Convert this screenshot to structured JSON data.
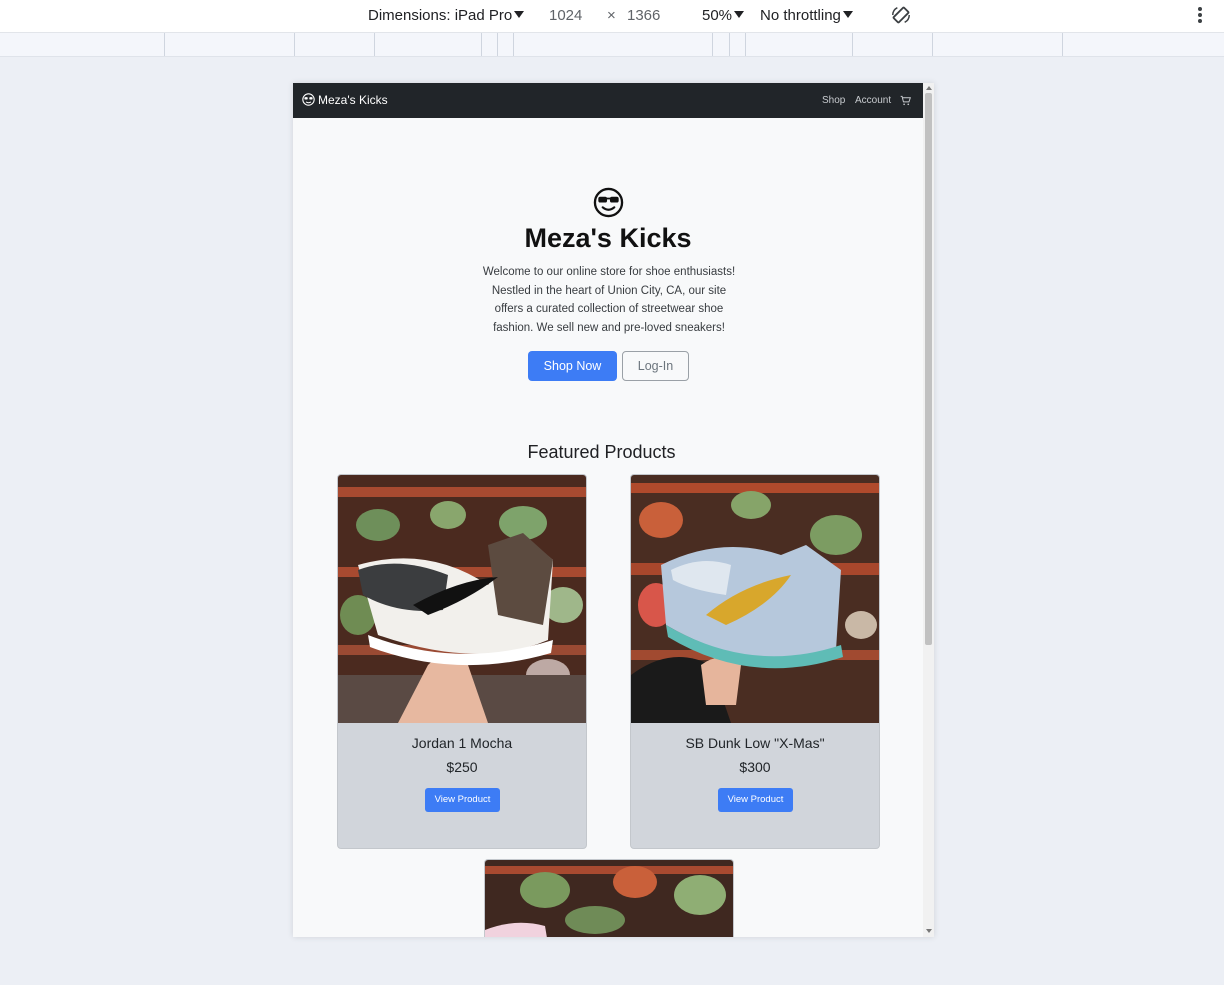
{
  "devtools": {
    "dimensions_label": "Dimensions: iPad Pro",
    "width": "1024",
    "times_symbol": "×",
    "height": "1366",
    "zoom": "50%",
    "throttling": "No throttling"
  },
  "site": {
    "brand": "Meza's Kicks",
    "nav": {
      "shop": "Shop",
      "account": "Account"
    },
    "hero": {
      "title": "Meza's Kicks",
      "description": "Welcome to our online store for shoe enthusiasts! Nestled in the heart of Union City, CA, our site offers a curated collection of streetwear shoe fashion. We sell new and pre-loved sneakers!",
      "shop_button": "Shop Now",
      "login_button": "Log-In"
    },
    "featured": {
      "title": "Featured Products",
      "products": [
        {
          "name": "Jordan 1 Mocha",
          "price": "$250",
          "button": "View Product"
        },
        {
          "name": "SB Dunk Low \"X-Mas\"",
          "price": "$300",
          "button": "View Product"
        }
      ]
    }
  },
  "colors": {
    "navbar": "#212529",
    "primary": "#3d7cf5",
    "card_bg": "#d1d5db",
    "page_bg": "#f8f9fa"
  }
}
